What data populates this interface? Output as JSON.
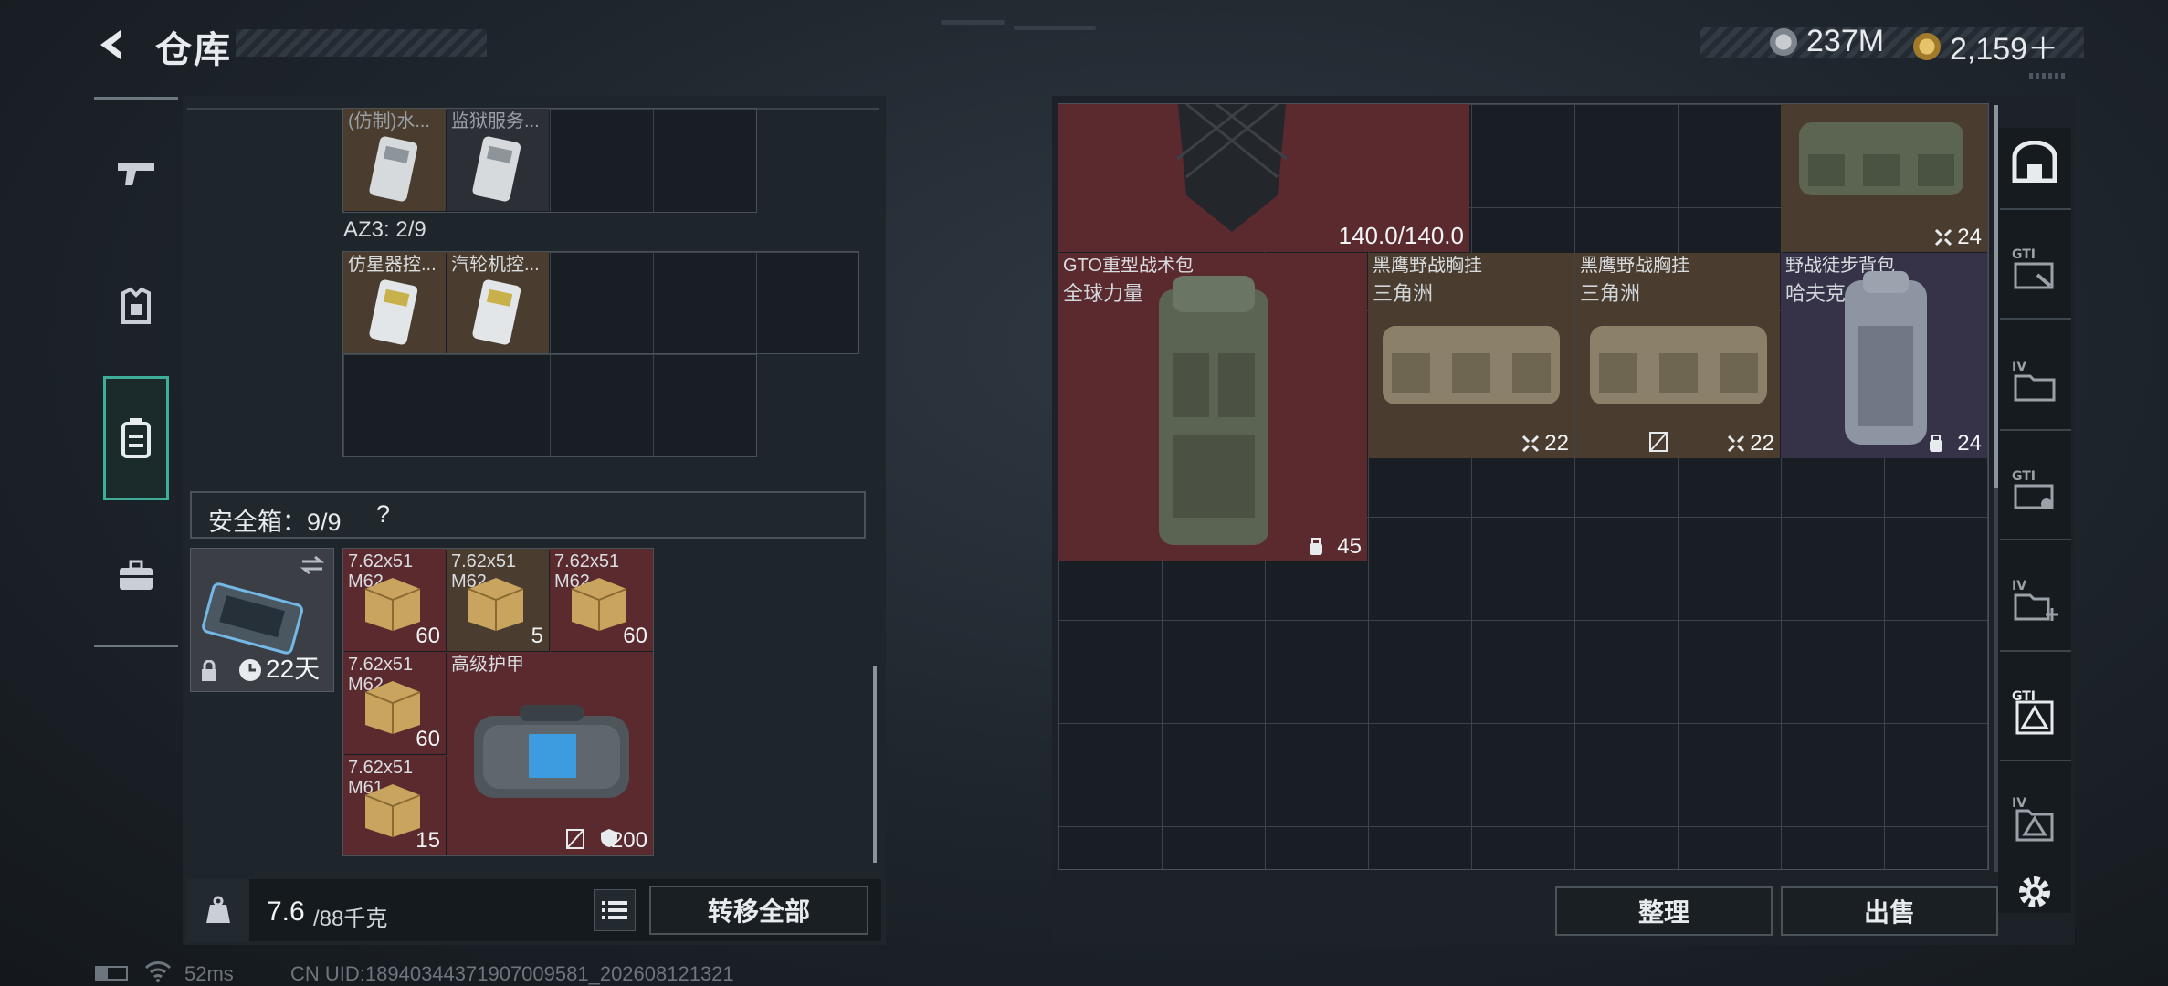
{
  "header": {
    "title": "仓库",
    "currency1": "237M",
    "currency2": "2,159＋"
  },
  "nav": {
    "items": [
      "weapon-icon",
      "armor-icon",
      "backpack-icon",
      "briefcase-icon"
    ]
  },
  "left": {
    "row1": [
      {
        "name": "(仿制)水..."
      },
      {
        "name": "监狱服务..."
      }
    ],
    "az3_label": "AZ3: 2/9",
    "row2": [
      {
        "name": "仿星器控..."
      },
      {
        "name": "汽轮机控..."
      }
    ],
    "safebox_label": "安全箱：9/9",
    "safebox_help": "?",
    "safebox_timer": "22天",
    "ammo": [
      {
        "name": "7.62x51 M62",
        "count": "60"
      },
      {
        "name": "7.62x51 M62",
        "count": "5"
      },
      {
        "name": "7.62x51 M62",
        "count": "60"
      },
      {
        "name": "7.62x51 M62",
        "count": "60"
      },
      {
        "name": "7.62x51 M61",
        "count": "15"
      }
    ],
    "armor_bag": {
      "name": "高级护甲",
      "count": "200"
    },
    "weight_value": "7.6",
    "weight_total": "/88千克",
    "transfer_all": "转移全部"
  },
  "right": {
    "top_durability": "140.0/140.0",
    "top_bag_count": "24",
    "items": [
      {
        "name": "GTO重型战术包",
        "sub": "全球力量",
        "count": "45"
      },
      {
        "name": "黑鹰野战胸挂",
        "sub": "三角洲",
        "count": "22"
      },
      {
        "name": "黑鹰野战胸挂",
        "sub": "三角洲",
        "count": "22"
      },
      {
        "name": "野战徒步背包",
        "sub": "哈夫克",
        "count": "24"
      }
    ],
    "sort_button": "整理",
    "sell_button": "出售"
  },
  "side_tabs": [
    "safe-icon",
    "gti-transfer-icon",
    "iv-folder-icon",
    "gti-camera-icon",
    "iv-add-icon",
    "gti-triangle-icon",
    "iv-triangle-icon",
    "gear-icon"
  ],
  "status": {
    "ping": "52ms",
    "uid": "CN UID:18940344371907009581_202608121321"
  }
}
